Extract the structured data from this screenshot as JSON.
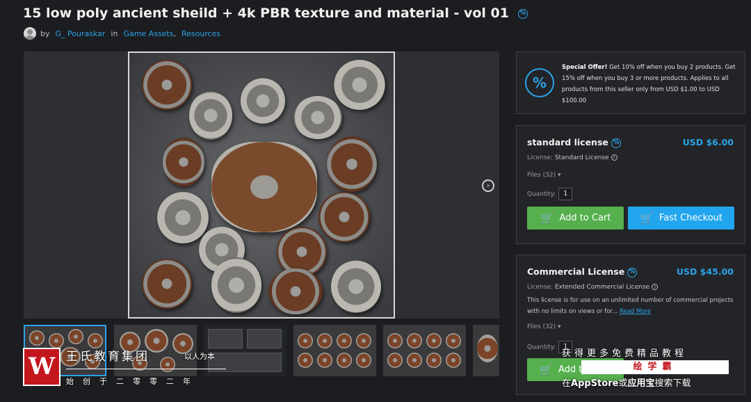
{
  "product": {
    "title": "15 low poly ancient sheild + 4k PBR texture and material - vol 01",
    "badge_icon": "%",
    "by_label": "by",
    "author": "G_ Pouraskar",
    "in_label": "in",
    "category1": "Game Assets",
    "separator": ",",
    "category2": "Resources"
  },
  "gallery": {
    "next_icon": "›",
    "thumbnail_count": 6
  },
  "offer": {
    "icon": "%",
    "label": "Special Offer!",
    "text": "Get 10% off when you buy 2 products. Get 15% off when you buy 3 or more products. Applies to all products from this seller only from USD $1.00 to USD $100.00"
  },
  "standard_license": {
    "name": "standard license",
    "badge": "%",
    "price": "USD $6.00",
    "license_label": "License:",
    "license_value": "Standard License",
    "help": "?",
    "files": "Files (32)",
    "files_chevron": "▾",
    "quantity_label": "Quantity:",
    "quantity": "1",
    "add_to_cart": "Add to Cart",
    "fast_checkout": "Fast Checkout"
  },
  "commercial_license": {
    "name": "Commercial License",
    "badge": "%",
    "price": "USD $45.00",
    "license_label": "License:",
    "license_value": "Extended Commercial License",
    "help": "?",
    "description": "This license is for use on an unlimited number of commercial projects with no limits on views or for...",
    "read_more": "Read More",
    "files": "Files (32)",
    "files_chevron": "▾",
    "quantity_label": "Quantity:",
    "quantity": "1",
    "add_to_cart": "Add to Card"
  },
  "watermark": {
    "logo": "W",
    "org_name": "王氏教育集团",
    "slogan": "以人为本",
    "founded": "始创于二零零二年",
    "promo_line1": "获得更多免费精品教程",
    "promo_brand": "绘学霸",
    "promo_line2_a": "在",
    "promo_line2_b": "AppStore",
    "promo_line2_c": "或",
    "promo_line2_d": "应用宝",
    "promo_line2_e": "搜索下载"
  },
  "colors": {
    "accent": "#2aa3e8",
    "cart_green": "#55b04d",
    "checkout_blue": "#21a5ee",
    "background": "#1c1d20",
    "watermark_red": "#c3161d"
  }
}
